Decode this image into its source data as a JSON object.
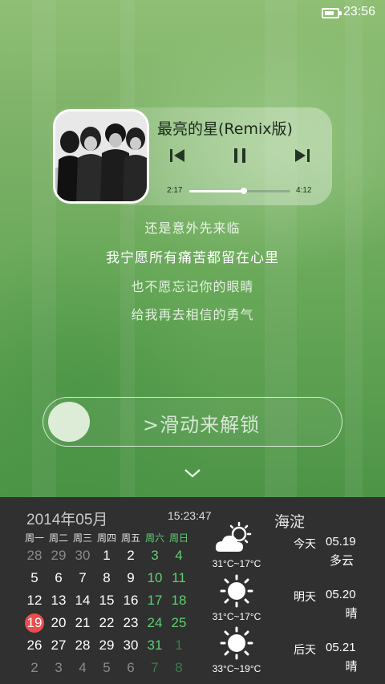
{
  "status_bar": {
    "time": "23:56",
    "battery_icon": "battery-icon"
  },
  "music": {
    "title": "最亮的星(Remix版)",
    "elapsed": "2:17",
    "total": "4:12",
    "progress": 0.54,
    "controls": [
      "previous-icon",
      "pause-icon",
      "next-icon"
    ],
    "lyrics": [
      "还是意外先来临",
      "我宁愿所有痛苦都留在心里",
      "也不愿忘记你的眼睛",
      "给我再去相信的勇气"
    ]
  },
  "unlock": {
    "label": ">滑动来解锁"
  },
  "panel": {
    "month": "2014年05月",
    "time": "15:23:47",
    "location": "海淀",
    "weekdays": [
      "周一",
      "周二",
      "周三",
      "周四",
      "周五",
      "周六",
      "周日"
    ],
    "calendar_rows": [
      [
        "28",
        "29",
        "30",
        "1",
        "2",
        "3",
        "4"
      ],
      [
        "5",
        "6",
        "7",
        "8",
        "9",
        "10",
        "11"
      ],
      [
        "12",
        "13",
        "14",
        "15",
        "16",
        "17",
        "18"
      ],
      [
        "19",
        "20",
        "21",
        "22",
        "23",
        "24",
        "25"
      ],
      [
        "26",
        "27",
        "28",
        "29",
        "30",
        "31",
        "1"
      ],
      [
        "2",
        "3",
        "4",
        "5",
        "6",
        "7",
        "8"
      ]
    ],
    "today": "19",
    "forecast": [
      {
        "day": "今天",
        "date": "05.19",
        "condition": "多云",
        "range": "31°C~17°C",
        "icon": "partly-cloudy-icon"
      },
      {
        "day": "明天",
        "date": "05.20",
        "condition": "晴",
        "range": "31°C~17°C",
        "icon": "sunny-icon"
      },
      {
        "day": "后天",
        "date": "05.21",
        "condition": "晴",
        "range": "33°C~19°C",
        "icon": "sunny-icon"
      }
    ]
  },
  "colors": {
    "weekend": "#5fcf73",
    "today": "#e94e4e",
    "panel_bg": "#2f302f"
  }
}
